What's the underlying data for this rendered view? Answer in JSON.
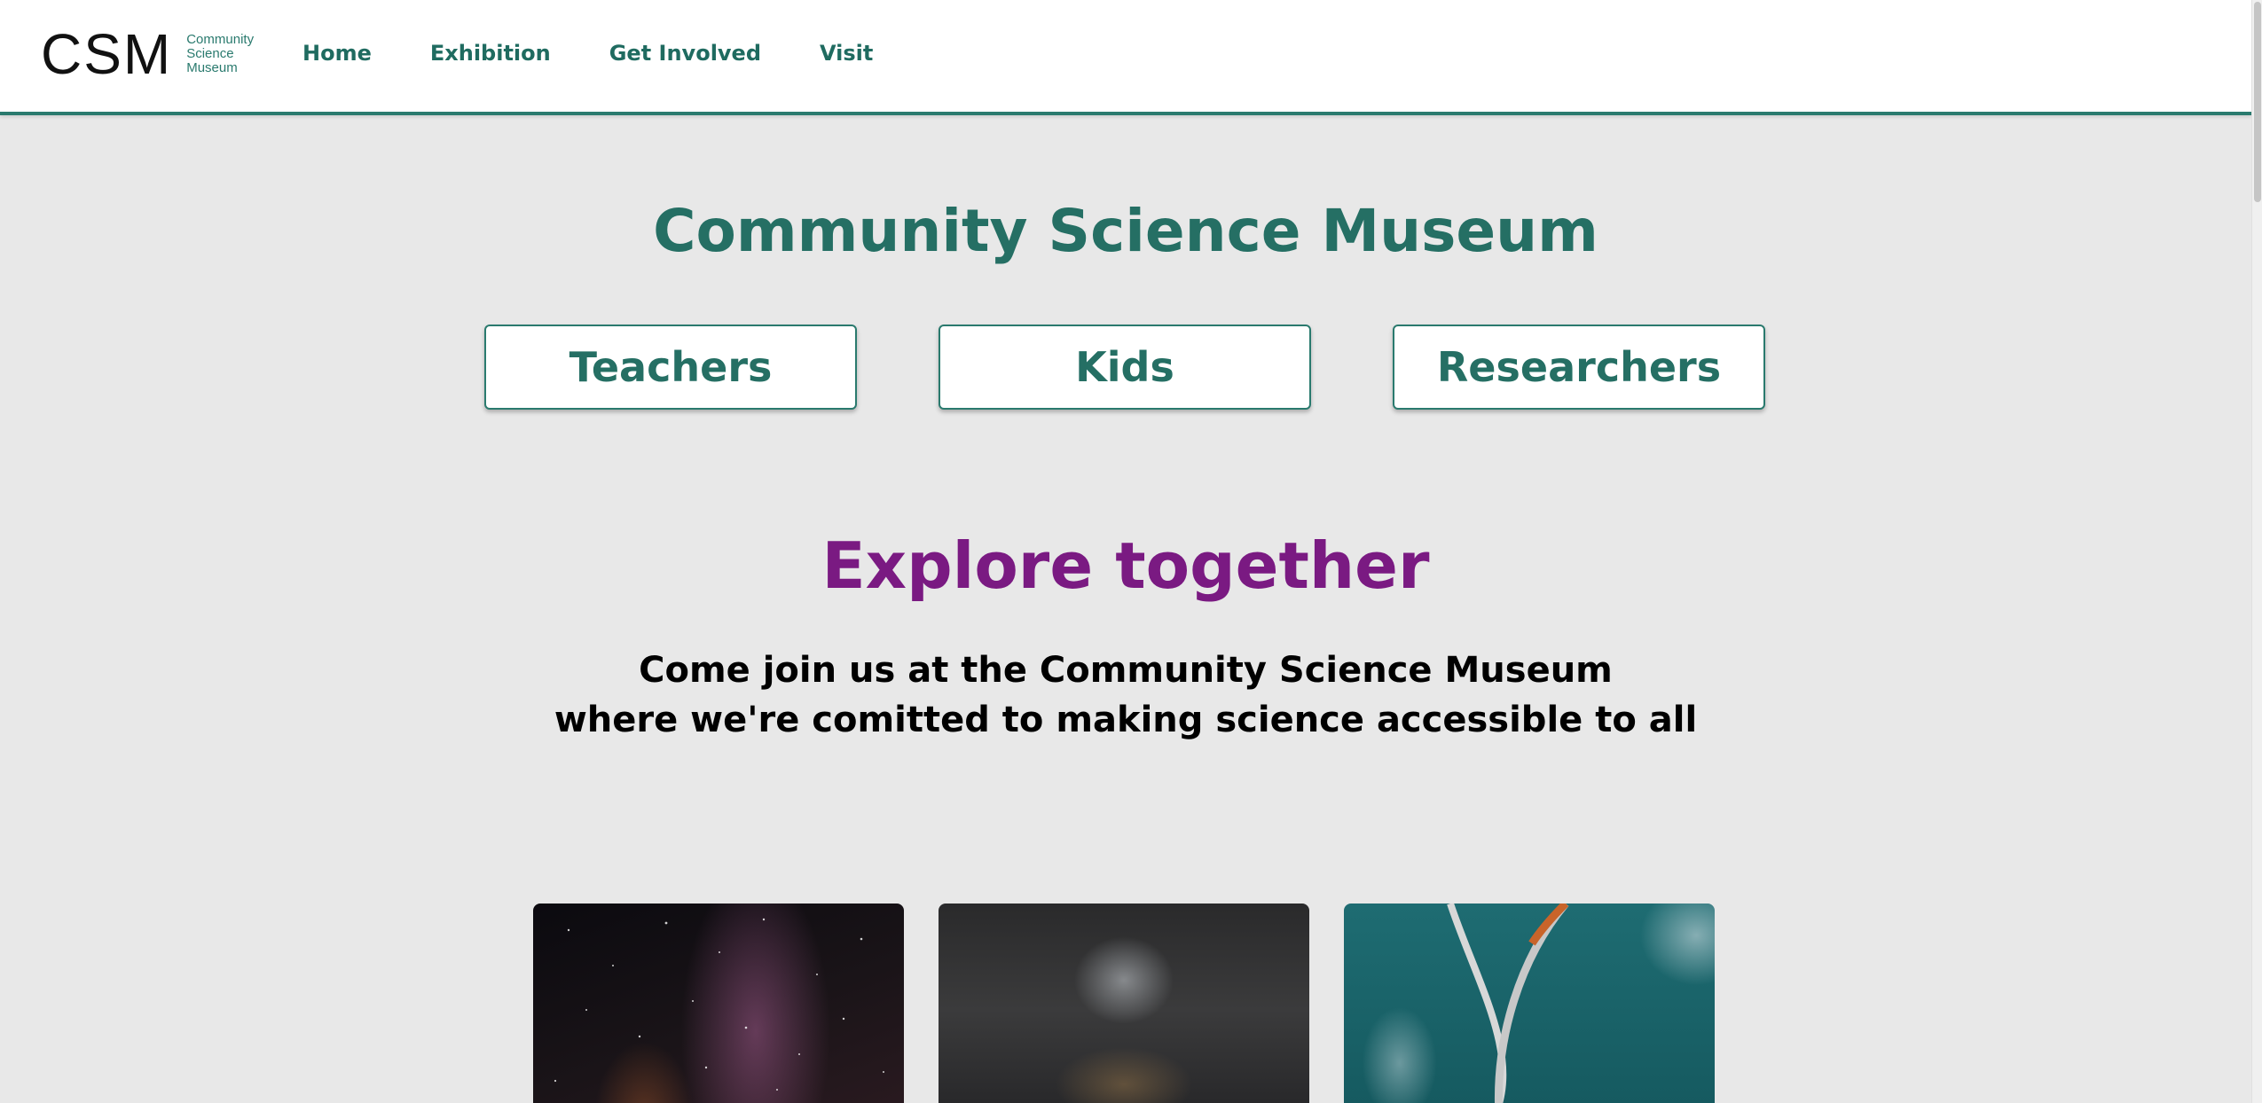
{
  "logo": {
    "mark": "CSM",
    "lines": [
      "Community",
      "Science",
      "Museum"
    ]
  },
  "nav": {
    "items": [
      {
        "label": "Home"
      },
      {
        "label": "Exhibition"
      },
      {
        "label": "Get Involved"
      },
      {
        "label": "Visit"
      }
    ]
  },
  "hero": {
    "title": "Community Science Museum",
    "audiences": [
      {
        "label": "Teachers"
      },
      {
        "label": "Kids"
      },
      {
        "label": "Researchers"
      }
    ]
  },
  "explore": {
    "heading": "Explore together",
    "tagline_line1": "Come join us at the Community Science Museum",
    "tagline_line2": "where we're comitted to making science accessible to all"
  },
  "colors": {
    "accent": "#2a7a6e",
    "title": "#256f64",
    "explore_heading": "#7a1a82",
    "background": "#e8e8e8"
  }
}
